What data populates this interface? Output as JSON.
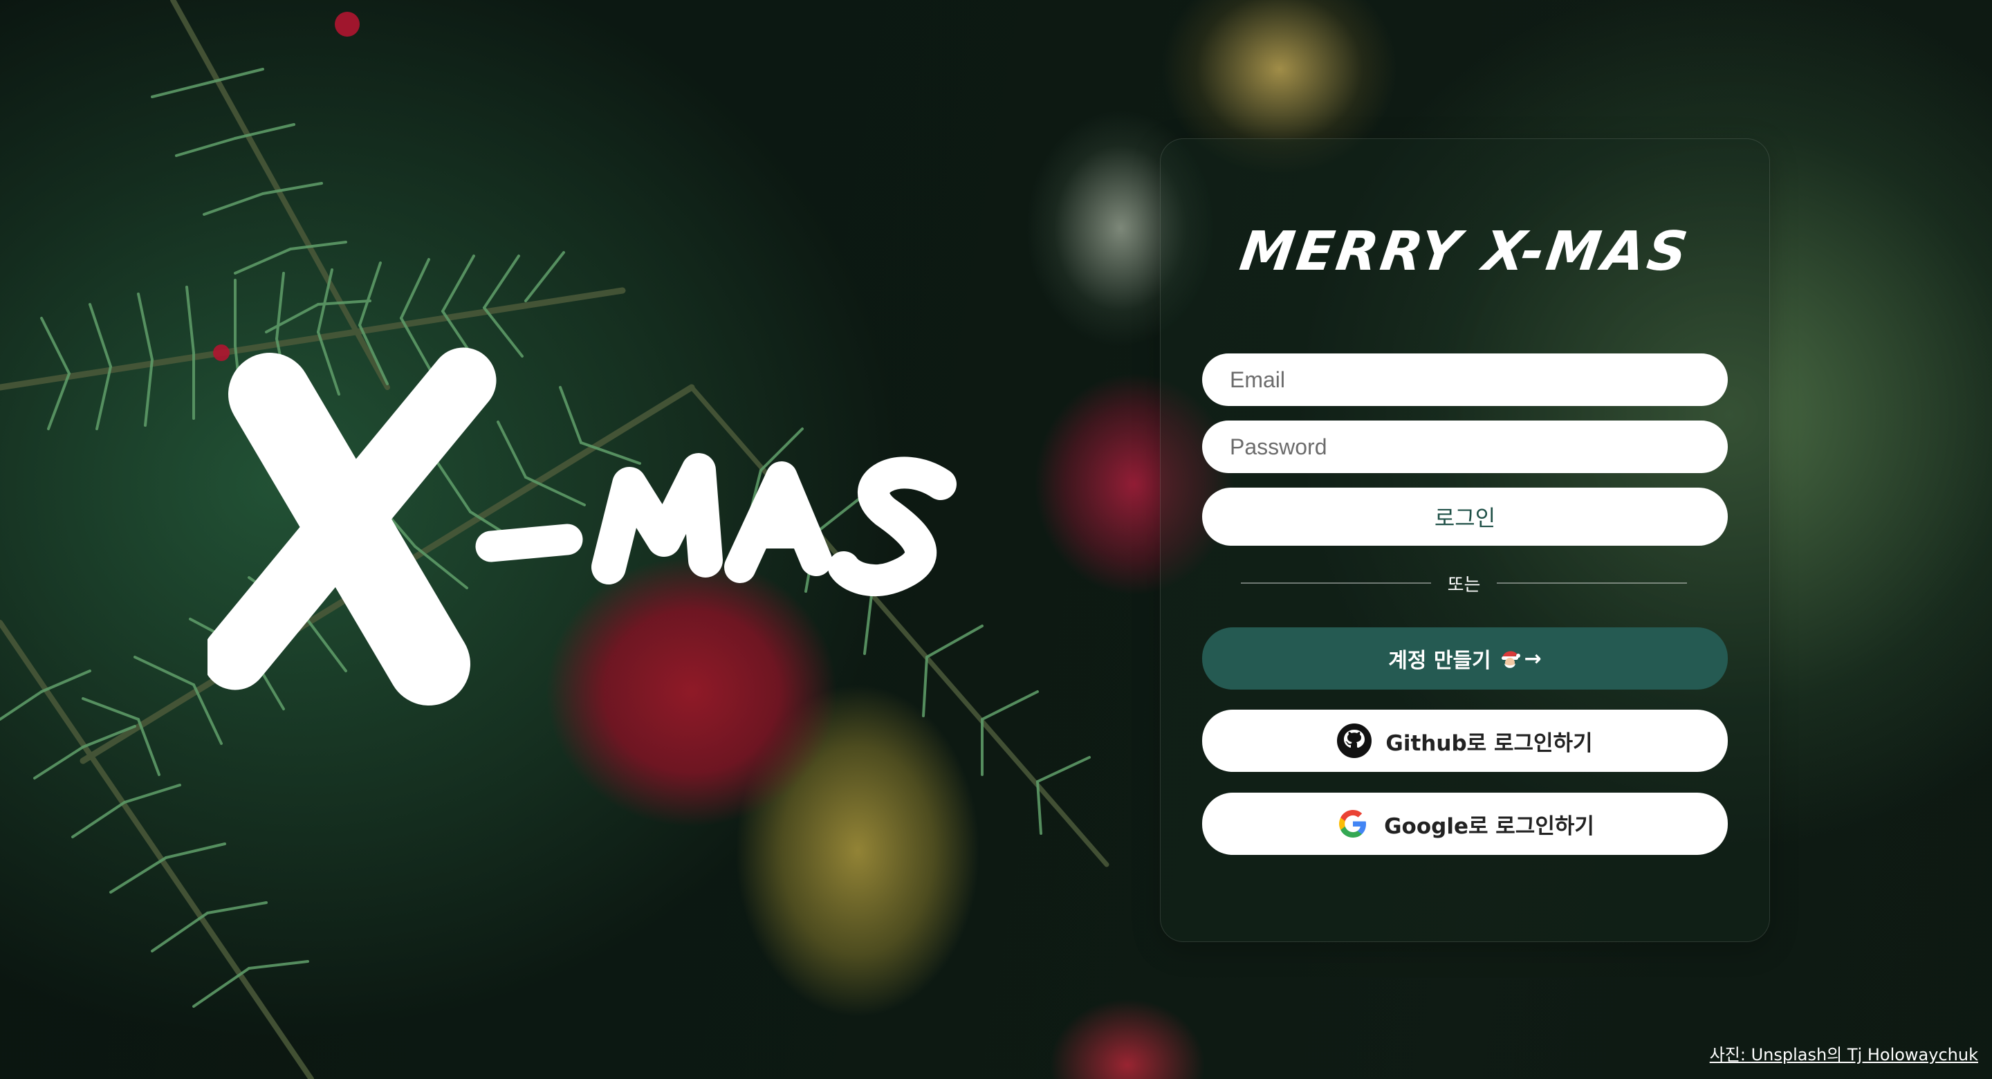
{
  "hero": {
    "text": "X-MAS"
  },
  "card": {
    "title": "MERRY X-MAS",
    "email_placeholder": "Email",
    "password_placeholder": "Password",
    "login_label": "로그인",
    "divider_label": "또는",
    "signup_label": "계정 만들기",
    "signup_arrow": "→",
    "github_label": "Github로 로그인하기",
    "google_label": "Google로 로그인하기"
  },
  "footer": {
    "credit_prefix": "사진: ",
    "credit_link": "Unsplash의 Tj Holowaychuk"
  },
  "icons": {
    "github": "github-icon",
    "google": "google-icon",
    "signup_emoji": "santa-emoji"
  },
  "colors": {
    "signup_button": "#255a52",
    "login_text": "#1f5047"
  }
}
